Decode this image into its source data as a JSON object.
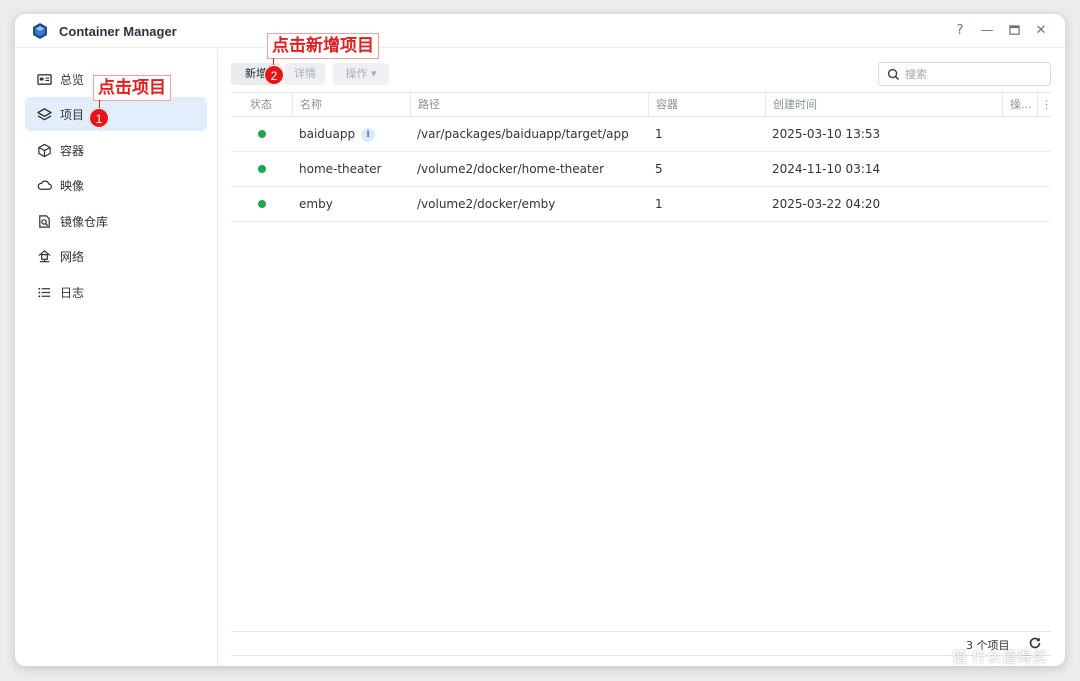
{
  "app": {
    "title": "Container Manager"
  },
  "window_controls": {
    "help": "?",
    "minimize": "—",
    "maximize": "□",
    "close": "✕"
  },
  "sidebar": {
    "items": [
      {
        "label": "总览",
        "icon": "overview-icon"
      },
      {
        "label": "项目",
        "icon": "layers-icon",
        "active": true
      },
      {
        "label": "容器",
        "icon": "cube-icon"
      },
      {
        "label": "映像",
        "icon": "cloud-icon"
      },
      {
        "label": "镜像仓库",
        "icon": "registry-icon"
      },
      {
        "label": "网络",
        "icon": "network-icon"
      },
      {
        "label": "日志",
        "icon": "list-icon"
      }
    ]
  },
  "toolbar": {
    "add_label": "新增",
    "details_label": "详情",
    "action_label": "操作 ▾",
    "search_placeholder": "搜索"
  },
  "table": {
    "headers": {
      "status": "状态",
      "name": "名称",
      "path": "路径",
      "containers": "容器",
      "created": "创建时间",
      "ops": "操..."
    },
    "rows": [
      {
        "name": "baiduapp",
        "info": "i",
        "path": "/var/packages/baiduapp/target/app",
        "containers": "1",
        "created": "2025-03-10 13:53",
        "status_color": "#1ea64a"
      },
      {
        "name": "home-theater",
        "path": "/volume2/docker/home-theater",
        "containers": "5",
        "created": "2024-11-10 03:14",
        "status_color": "#1ea64a"
      },
      {
        "name": "emby",
        "path": "/volume2/docker/emby",
        "containers": "1",
        "created": "2025-03-22 04:20",
        "status_color": "#1ea64a"
      }
    ]
  },
  "footer": {
    "count": "3 个项目"
  },
  "annotations": {
    "step1_text": "点击项目",
    "step1_num": "1",
    "step2_text": "点击新增项目",
    "step2_num": "2"
  },
  "watermark": "值 什么值得买",
  "colors": {
    "accent": "#e02020",
    "active_bg": "#e2eefb",
    "status_ok": "#1ea64a"
  }
}
